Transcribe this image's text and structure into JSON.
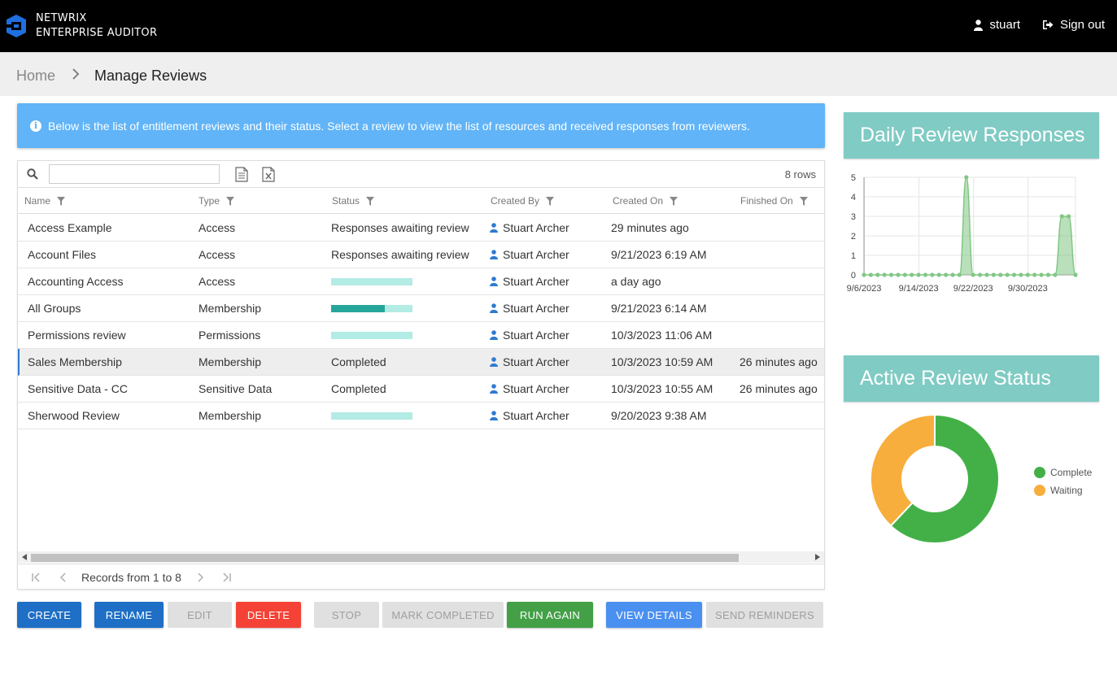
{
  "header": {
    "brand_line1": "NETWRIX",
    "brand_line2": "ENTERPRISE AUDITOR",
    "user": "stuart",
    "signout": "Sign out"
  },
  "breadcrumb": {
    "home": "Home",
    "current": "Manage Reviews"
  },
  "info_text": "Below is the list of entitlement reviews and their status. Select a review to view the list of resources and received responses from reviewers.",
  "grid": {
    "rows_count": "8 rows",
    "search_value": "",
    "columns": [
      "Name",
      "Type",
      "Status",
      "Created By",
      "Created On",
      "Finished On"
    ],
    "rows": [
      {
        "name": "Access Example",
        "type": "Access",
        "status": "Responses awaiting review",
        "progress": null,
        "created_by": "Stuart Archer",
        "created_on": "29 minutes ago",
        "finished_on": ""
      },
      {
        "name": "Account Files",
        "type": "Access",
        "status": "Responses awaiting review",
        "progress": null,
        "created_by": "Stuart Archer",
        "created_on": "9/21/2023 6:19 AM",
        "finished_on": ""
      },
      {
        "name": "Accounting Access",
        "type": "Access",
        "status": "",
        "progress": 0,
        "created_by": "Stuart Archer",
        "created_on": "a day ago",
        "finished_on": ""
      },
      {
        "name": "All Groups",
        "type": "Membership",
        "status": "",
        "progress": 0.66,
        "created_by": "Stuart Archer",
        "created_on": "9/21/2023 6:14 AM",
        "finished_on": ""
      },
      {
        "name": "Permissions review",
        "type": "Permissions",
        "status": "",
        "progress": 0,
        "created_by": "Stuart Archer",
        "created_on": "10/3/2023 11:06 AM",
        "finished_on": ""
      },
      {
        "name": "Sales Membership",
        "type": "Membership",
        "status": "Completed",
        "progress": null,
        "created_by": "Stuart Archer",
        "created_on": "10/3/2023 10:59 AM",
        "finished_on": "26 minutes ago",
        "selected": true
      },
      {
        "name": "Sensitive Data - CC",
        "type": "Sensitive Data",
        "status": "Completed",
        "progress": null,
        "created_by": "Stuart Archer",
        "created_on": "10/3/2023 10:55 AM",
        "finished_on": "26 minutes ago"
      },
      {
        "name": "Sherwood Review",
        "type": "Membership",
        "status": "",
        "progress": 0,
        "created_by": "Stuart Archer",
        "created_on": "9/20/2023 9:38 AM",
        "finished_on": ""
      }
    ],
    "pager_text": "Records from 1 to 8"
  },
  "buttons": {
    "create": "CREATE",
    "rename": "RENAME",
    "edit": "EDIT",
    "delete": "DELETE",
    "stop": "STOP",
    "mark_completed": "MARK COMPLETED",
    "run_again": "RUN AGAIN",
    "view_details": "VIEW DETAILS",
    "send_reminders": "SEND REMINDERS"
  },
  "widgets": {
    "daily_title": "Daily Review Responses",
    "status_title": "Active Review Status"
  },
  "chart_data": [
    {
      "type": "area",
      "title": "Daily Review Responses",
      "x_tick_labels": [
        "9/6/2023",
        "9/14/2023",
        "9/22/2023",
        "9/30/2023"
      ],
      "y_ticks": [
        0,
        1,
        2,
        3,
        4,
        5
      ],
      "ylim": [
        0,
        5
      ],
      "values": [
        0,
        0,
        0,
        0,
        0,
        0,
        0,
        0,
        0,
        0,
        0,
        0,
        0,
        0,
        0,
        5,
        0,
        0,
        0,
        0,
        0,
        0,
        0,
        0,
        0,
        0,
        0,
        0,
        0,
        3,
        3,
        0
      ],
      "color": "#81c784"
    },
    {
      "type": "pie",
      "title": "Active Review Status",
      "labels": [
        "Complete",
        "Waiting"
      ],
      "values": [
        62,
        38
      ],
      "colors": [
        "#43b047",
        "#f7ae3c"
      ],
      "legend": "right"
    }
  ],
  "colors": {
    "topbar": "#000000",
    "banner": "#61b4f7",
    "widget_header": "#80cbc4",
    "progress_fill": "#26a69a",
    "progress_bg": "#b3ebe5"
  }
}
